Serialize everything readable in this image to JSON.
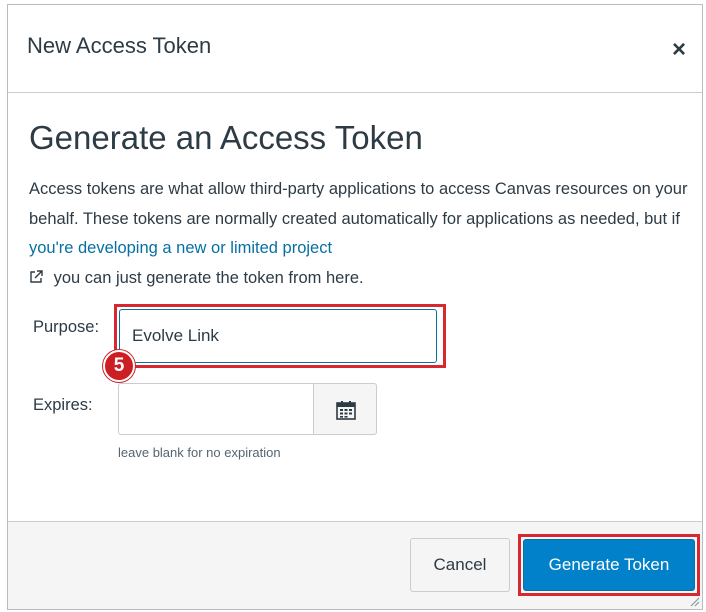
{
  "dialog": {
    "title": "New Access Token",
    "close_label": "×"
  },
  "content": {
    "heading": "Generate an Access Token",
    "description_before_link": "Access tokens are what allow third-party applications to access Canvas resources on your behalf. These tokens are normally created automatically for applications as needed, but if ",
    "link_text": "you're developing a new or limited project",
    "description_after_link": " you can just generate the token from here."
  },
  "form": {
    "purpose_label": "Purpose:",
    "purpose_value": "Evolve Link",
    "expires_label": "Expires:",
    "expires_value": "",
    "expires_hint": "leave blank for no expiration",
    "calendar_icon": "calendar-icon"
  },
  "annotation": {
    "step_number": "5",
    "highlight_color": "#d8282f"
  },
  "footer": {
    "cancel_label": "Cancel",
    "generate_label": "Generate Token"
  },
  "colors": {
    "link": "#0770a3",
    "primary_button": "#0081c9",
    "text": "#2d3b45"
  }
}
